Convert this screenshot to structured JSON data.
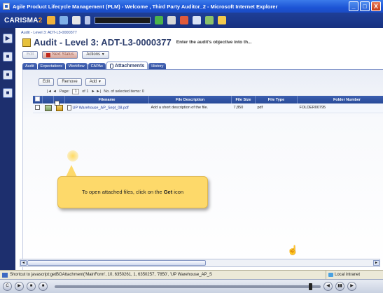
{
  "window": {
    "title": "Agile Product Lifecycle Management (PLM) - Welcome , Third Party Auditor_2 - Microsoft Internet Explorer",
    "buttons": [
      "_",
      "□",
      "X"
    ]
  },
  "app_toolbar": {
    "logo_text": "CARISMA",
    "logo_accent": "2",
    "icons": [
      "home-icon",
      "save-icon",
      "print-icon",
      "dropdown-icon",
      "refresh-icon",
      "search-icon",
      "user-icon",
      "report-icon",
      "tools-icon",
      "workflow-icon"
    ],
    "progress": 1.0
  },
  "left_rail": {
    "buttons": [
      "▶",
      "■",
      "■",
      "■"
    ]
  },
  "page": {
    "breadcrumb": "Audit - Level 3: ADT-L3-0000377",
    "title": "Audit - Level 3: ADT-L3-0000377",
    "objective": "Enter the audit's objective into th...",
    "action_buttons": {
      "disabled_button": "Edit",
      "status_button": "Next Status",
      "actions": "Actions"
    },
    "tabs": [
      "Audit",
      "Expectations",
      "Workflow",
      "CAPAs",
      "Attachments",
      "History"
    ],
    "active_tab": "Attachments"
  },
  "attachments": {
    "toolbar": {
      "edit": "Edit",
      "remove": "Remove",
      "add": "Add"
    },
    "pager": {
      "first_prev": "|◄ ◄",
      "page_label": "Page:",
      "page_value": "1",
      "of_label": "of 1",
      "next_last": "► ►|",
      "selected_label": "No. of selected items: 0"
    },
    "columns": [
      "",
      "",
      "",
      "Filename",
      "File Description",
      "File Size",
      "File Type",
      "Folder Number"
    ],
    "rows": [
      {
        "filename": "UP Warehouse_AP_Sept_08.pdf",
        "description": "Add a short description of the file.",
        "size": "7,850",
        "type": "pdf",
        "folder": "FOLDER00795"
      }
    ]
  },
  "callout": {
    "prefix": "To open attached files, click on the ",
    "bold": "Get",
    "suffix": " icon"
  },
  "status_bar": {
    "text": "Shortcut to javascript:getBOAttachment('MainForm', 10, 6350261, 1, 6350257, '7850', 'UP Warehouse_AP_S",
    "zone": "Local intranet"
  },
  "player": {
    "buttons": [
      "C",
      "▶",
      "■",
      "■"
    ],
    "right_buttons": [
      "◀",
      "▮▮",
      "▶"
    ],
    "position": 0.97
  },
  "colors": {
    "titlebar": "#1c54d6",
    "toolbar": "#1f3f97",
    "tab": "#2e4d9e",
    "callout": "#fdd96a"
  }
}
